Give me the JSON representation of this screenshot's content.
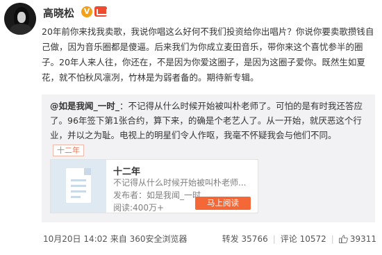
{
  "post": {
    "author": "高晓松",
    "verified_badge": "V",
    "text": "20年前你来找我卖歌，我说你唱这么好何不我们投资给你出唱片？你说你要卖歌攒钱自己做，因为音乐圈都是傻逼。后来我们为你成立麦田音乐，带你来这个喜忧参半的圈子。20年人来人往，你还在，不是因为你爱这圈子，是因为这圈子爱你。既然生如夏花，就不怕秋风凛冽，竹林是为弱者备的。期待新专辑。"
  },
  "repost": {
    "author": "@如是我闻_一时_",
    "text": "：不记得从什么时候开始被叫朴老师了。可怕的是有时我还答应了。96年签下第1张合约，算下来，的确是个老艺人了。从一开始，就厌恶这个行业，并以之为耻。电视上的明星们令人作呕，我毫不怀疑我会与他们不同。",
    "topic_tag": "十二年",
    "card": {
      "title": "十二年",
      "description": "不记得从什么时候开始被叫朴老师...",
      "publisher": "发布者：如是我闻_一时_",
      "reads": "阅读:400万+",
      "read_button": "马上阅读"
    }
  },
  "footer": {
    "timestamp_source": "10月20日 14:02 来自 360安全浏览器",
    "repost_label": "转发 35766",
    "comment_label": "评论 10572",
    "like_count": "39311"
  },
  "colors": {
    "accent": "#eb7350",
    "verify": "#f3a11c",
    "button": "#f46737",
    "repost_bg": "#f2f2f5"
  }
}
